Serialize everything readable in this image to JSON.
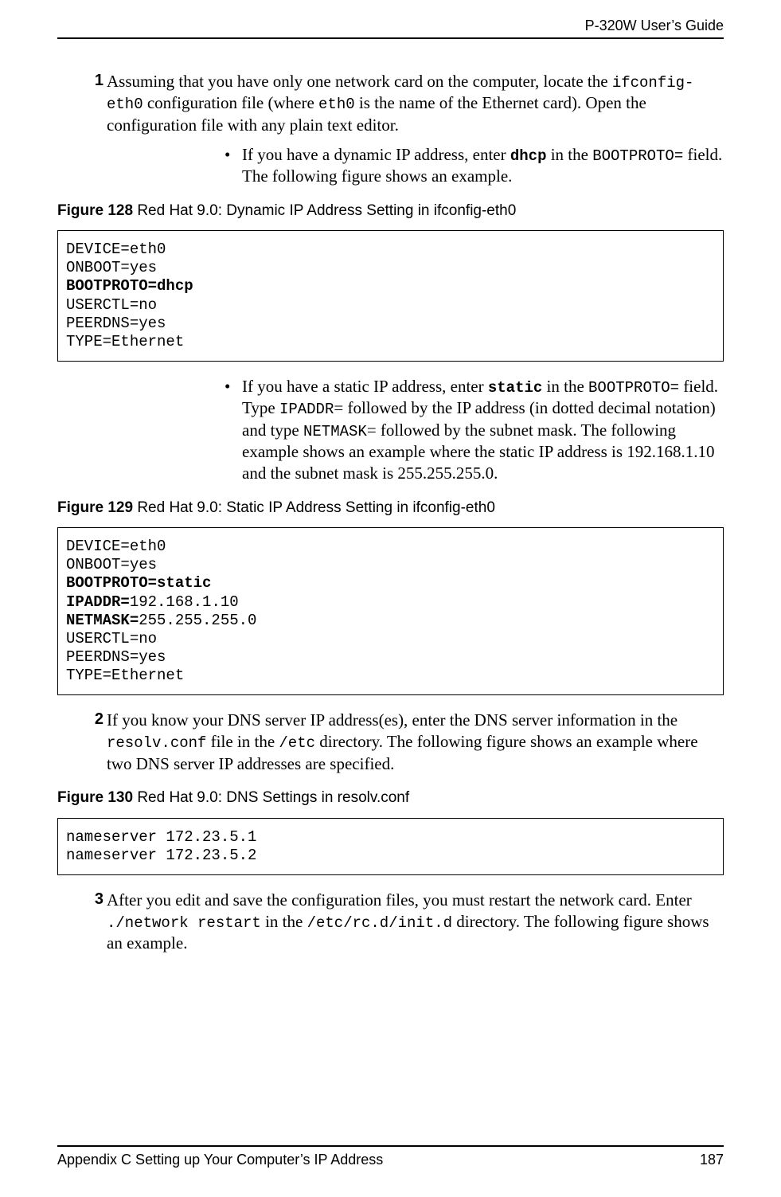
{
  "header": {
    "title": "P-320W User’s Guide"
  },
  "footer": {
    "left": "Appendix C Setting up Your Computer’s IP Address",
    "right": "187"
  },
  "steps": {
    "s1": {
      "num": "1",
      "t1": "Assuming that you have only one network card on the computer, locate the ",
      "c1": "ifconfig-eth0",
      "t2": " configuration file (where ",
      "c2": "eth0",
      "t3": " is the name of the Ethernet card). Open the configuration file with any plain text editor."
    },
    "b1": {
      "t1": "If you have a dynamic IP address, enter ",
      "c1": "dhcp",
      "t2": " in the ",
      "c2": "BOOTPROTO=",
      "t3": " field.  The following figure shows an example."
    },
    "b2": {
      "t1": "If you have a static IP address, enter ",
      "c1": "static",
      "t2": " in the ",
      "c2": "BOOTPROTO=",
      "t3": " field. Type ",
      "c3": "IPADDR",
      "t4": "= followed by the IP address (in dotted decimal notation) and type ",
      "c4": "NETMASK",
      "t5": "= followed by the subnet mask. The following example shows an example where the static IP address is 192.168.1.10 and the subnet mask is 255.255.255.0."
    },
    "s2": {
      "num": "2",
      "t1": "If you know your DNS server IP address(es), enter the DNS server information in the ",
      "c1": "resolv.conf",
      "t2": " file in the ",
      "c2": "/etc",
      "t3": " directory.  The following figure shows an example where two DNS server IP addresses are specified."
    },
    "s3": {
      "num": "3",
      "t1": "After you edit and save the configuration files, you must restart the network card. Enter ",
      "c1": "./network restart",
      "t2": " in the ",
      "c2": "/etc/rc.d/init.d",
      "t3": "  directory.  The following figure shows an example."
    }
  },
  "figures": {
    "f128": {
      "label": "Figure 128   ",
      "caption": "Red Hat 9.0: Dynamic IP Address Setting in ifconfig-eth0"
    },
    "f129": {
      "label": "Figure 129   ",
      "caption": "Red Hat 9.0: Static IP Address Setting in ifconfig-eth0"
    },
    "f130": {
      "label": "Figure 130   ",
      "caption": "Red Hat 9.0: DNS Settings in resolv.conf"
    }
  },
  "code": {
    "c128": {
      "l1": "DEVICE=eth0",
      "l2": "ONBOOT=yes",
      "l3": "BOOTPROTO=dhcp",
      "l4": "USERCTL=no",
      "l5": "PEERDNS=yes",
      "l6": "TYPE=Ethernet"
    },
    "c129": {
      "l1": "DEVICE=eth0",
      "l2": "ONBOOT=yes",
      "l3": "BOOTPROTO=static",
      "l4a": "IPADDR=",
      "l4b": "192.168.1.10",
      "l5a": "NETMASK=",
      "l5b": "255.255.255.0",
      "l6": "USERCTL=no",
      "l7": "PEERDNS=yes",
      "l8": "TYPE=Ethernet"
    },
    "c130": {
      "l1": "nameserver 172.23.5.1",
      "l2": "nameserver 172.23.5.2"
    }
  }
}
